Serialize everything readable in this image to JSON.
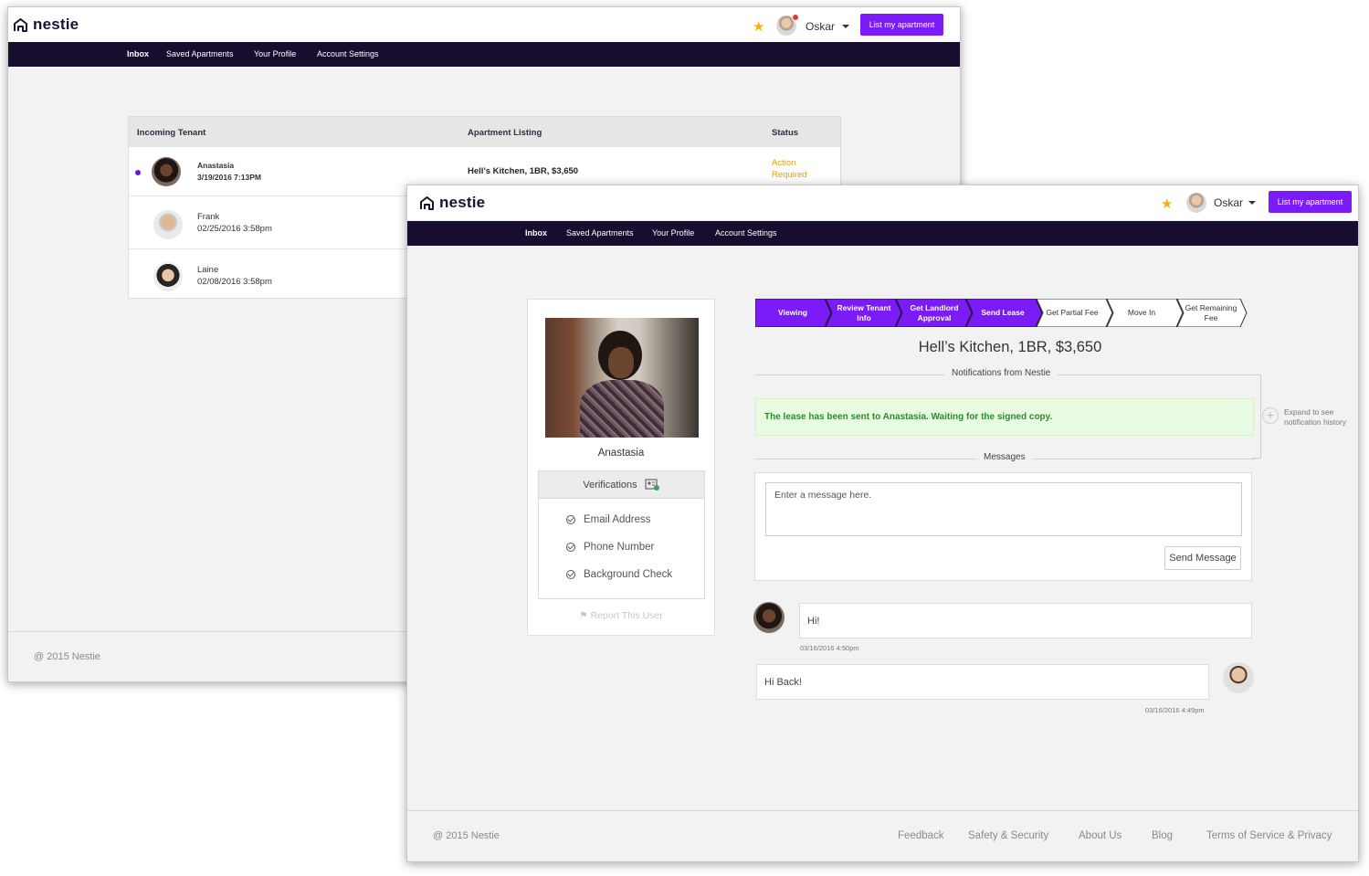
{
  "brand": {
    "name": "nestie"
  },
  "header": {
    "user_name": "Oskar",
    "cta_label": "List my apartment"
  },
  "nav": {
    "items": [
      "Inbox",
      "Saved Apartments",
      "Your Profile",
      "Account Settings"
    ]
  },
  "inbox": {
    "columns": [
      "Incoming Tenant",
      "Apartment Listing",
      "Status"
    ],
    "rows": [
      {
        "name": "Anastasia",
        "date": "3/19/2016  7:13PM",
        "listing": "Hell’s Kitchen, 1BR, $3,650",
        "status": "Action Required",
        "unread": true
      },
      {
        "name": "Frank",
        "date": "02/25/2016 3:58pm",
        "listing": "",
        "status": "",
        "unread": false
      },
      {
        "name": "Laine",
        "date": "02/08/2016 3:58pm",
        "listing": "",
        "status": "",
        "unread": false
      }
    ]
  },
  "footer": {
    "copyright": "@ 2015 Nestie",
    "links": [
      "Feedback",
      "Safety & Security",
      "About Us",
      "Blog",
      "Terms of Service & Privacy"
    ]
  },
  "profile": {
    "name": "Anastasia",
    "verifications_title": "Verifications",
    "verifications": [
      "Email Address",
      "Phone Number",
      "Background Check"
    ],
    "report_label": "Report This User"
  },
  "steps": [
    {
      "label": "Viewing",
      "done": true
    },
    {
      "label": "Review Tenant Info",
      "done": true
    },
    {
      "label": "Get Landlord Approval",
      "done": true
    },
    {
      "label": "Send Lease",
      "done": true
    },
    {
      "label": "Get Partial Fee",
      "done": false
    },
    {
      "label": "Move In",
      "done": false
    },
    {
      "label": "Get Remaining Fee",
      "done": false
    }
  ],
  "detail": {
    "listing_title": "Hell’s Kitchen, 1BR, $3,650",
    "notifications_label": "Notifications from Nestie",
    "notification_text": "The lease has been sent to Anastasia. Waiting for the signed copy.",
    "expand_hint": "Expand to see notification history",
    "messages_label": "Messages",
    "message_placeholder": "Enter a message here.",
    "send_label": "Send Message",
    "chat": [
      {
        "text": "Hi!",
        "time": "03/16/2016 4:50pm",
        "from": "tenant"
      },
      {
        "text": "Hi Back!",
        "time": "03/16/2016 4:49pm",
        "from": "me"
      }
    ]
  },
  "colors": {
    "accent": "#7b1bf7",
    "navbar": "#180d2e",
    "status_warning": "#e0a10a",
    "notice_text": "#2e8a33",
    "star": "#f5b500"
  }
}
